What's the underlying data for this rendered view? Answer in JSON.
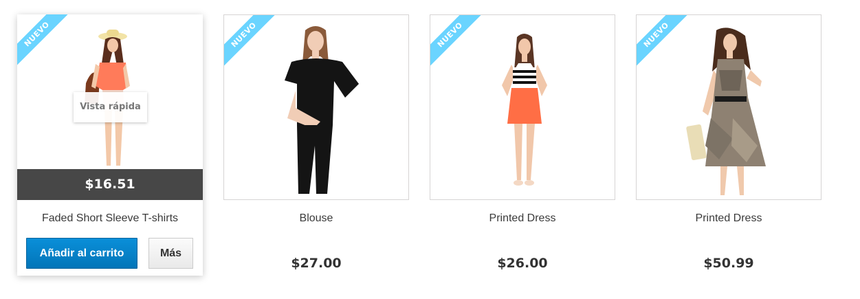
{
  "products": [
    {
      "badge": "NUEVO",
      "name": "Faded Short Sleeve T-shirts",
      "price": "$16.51",
      "quick_view": "Vista rápida",
      "add_to_cart": "Añadir al carrito",
      "more": "Más"
    },
    {
      "badge": "NUEVO",
      "name": "Blouse",
      "price": "$27.00"
    },
    {
      "badge": "NUEVO",
      "name": "Printed Dress",
      "price": "$26.00"
    },
    {
      "badge": "NUEVO",
      "name": "Printed Dress",
      "price": "$50.99"
    }
  ],
  "colors": {
    "ribbon": "#6ad4ff",
    "price_bar": "#474747",
    "cart_button": "#0a8fd9"
  }
}
